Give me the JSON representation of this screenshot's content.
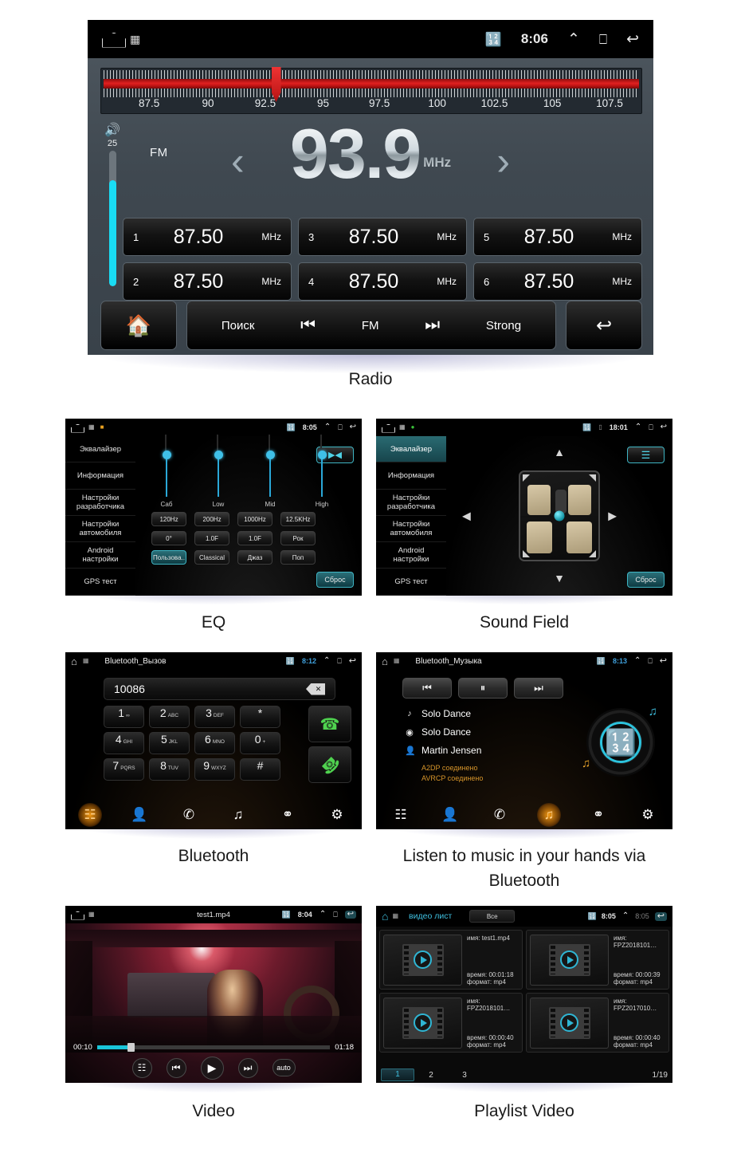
{
  "captions": {
    "radio": "Radio",
    "eq": "EQ",
    "sound_field": "Sound Field",
    "bluetooth": "Bluetooth",
    "bluetooth_music": "Listen to music in your hands via Bluetooth",
    "video": "Video",
    "playlist_video": "Playlist Video"
  },
  "radio": {
    "status": {
      "time": "8:06",
      "bluetooth_icon": "bluetooth-icon",
      "home_icon": "home-icon",
      "app_icon": "app-icon",
      "up_icon": "chevron-up-icon",
      "recents_icon": "recents-icon",
      "back_icon": "back-icon"
    },
    "tuner": {
      "labels": [
        "87.5",
        "90",
        "92.5",
        "95",
        "97.5",
        "100",
        "102.5",
        "105",
        "107.5"
      ],
      "needle_value": "93.9",
      "range_min": 87.0,
      "range_max": 108.5
    },
    "volume": {
      "level": "25",
      "percent": 78
    },
    "band": "FM",
    "frequency": "93.9",
    "unit": "MHz",
    "prev_arrow": "‹",
    "next_arrow": "›",
    "presets": [
      {
        "index": "1",
        "freq": "87.50",
        "unit": "MHz"
      },
      {
        "index": "3",
        "freq": "87.50",
        "unit": "MHz"
      },
      {
        "index": "5",
        "freq": "87.50",
        "unit": "MHz"
      },
      {
        "index": "2",
        "freq": "87.50",
        "unit": "MHz"
      },
      {
        "index": "4",
        "freq": "87.50",
        "unit": "MHz"
      },
      {
        "index": "6",
        "freq": "87.50",
        "unit": "MHz"
      }
    ],
    "toolbar": {
      "home": "⌂",
      "search": "Поиск",
      "prev": "⏮",
      "band": "FM",
      "next": "⏭",
      "strong": "Strong",
      "back": "↩"
    }
  },
  "eq": {
    "status": {
      "time": "8:05"
    },
    "menu": [
      {
        "label": "Эквалайзер",
        "active": false
      },
      {
        "label": "Информация",
        "active": false
      },
      {
        "label": "Настройки разработчика",
        "active": false
      },
      {
        "label": "Настройки автомобиля",
        "active": false
      },
      {
        "label": "Android настройки",
        "active": false
      },
      {
        "label": "GPS тест",
        "active": false
      }
    ],
    "sliders": [
      {
        "label": "Саб"
      },
      {
        "label": "Low"
      },
      {
        "label": "Mid"
      },
      {
        "label": "High"
      }
    ],
    "buttons_row1": [
      "120Hz",
      "200Hz",
      "1000Hz",
      "12.5KHz"
    ],
    "buttons_row2": [
      "0°",
      "1.0F",
      "1.0F",
      "Рок"
    ],
    "buttons_row3": [
      "Пользова..",
      "Classical",
      "Джаз",
      "Поп"
    ],
    "active_preset_index": 0,
    "top_button_icon": "balance-icon",
    "reset_label": "Сброс"
  },
  "sound_field": {
    "status": {
      "time": "18:01"
    },
    "menu": [
      {
        "label": "Эквалайзер",
        "active": true
      },
      {
        "label": "Информация",
        "active": false
      },
      {
        "label": "Настройки разработчика",
        "active": false
      },
      {
        "label": "Настройки автомобиля",
        "active": false
      },
      {
        "label": "Android настройки",
        "active": false
      },
      {
        "label": "GPS тест",
        "active": false
      }
    ],
    "top_button_icon": "equalizer-icon",
    "reset_label": "Сброс",
    "arrows": {
      "up": "▲",
      "down": "▼",
      "left": "◀",
      "right": "▶"
    }
  },
  "bluetooth": {
    "status": {
      "time": "8:12"
    },
    "title": "Bluetooth_Вызов",
    "dial_value": "10086",
    "backspace_icon": "backspace-icon",
    "keys": [
      {
        "big": "1",
        "sub": "∞"
      },
      {
        "big": "2",
        "sub": "ABC"
      },
      {
        "big": "3",
        "sub": "DEF"
      },
      {
        "big": "*",
        "sub": ""
      },
      {
        "big": "4",
        "sub": "GHI"
      },
      {
        "big": "5",
        "sub": "JKL"
      },
      {
        "big": "6",
        "sub": "MNO"
      },
      {
        "big": "0",
        "sub": "+"
      },
      {
        "big": "7",
        "sub": "PQRS"
      },
      {
        "big": "8",
        "sub": "TUV"
      },
      {
        "big": "9",
        "sub": "WXYZ"
      },
      {
        "big": "#",
        "sub": ""
      }
    ],
    "call_icon": "call-icon",
    "hangup_icon": "hangup-icon",
    "tabs": [
      {
        "icon": "keypad-icon",
        "glyph": "☷",
        "active": true
      },
      {
        "icon": "contacts-icon",
        "glyph": "὆4",
        "active": false
      },
      {
        "icon": "call-history-icon",
        "glyph": "✆",
        "active": false
      },
      {
        "icon": "music-icon",
        "glyph": "♫",
        "active": false
      },
      {
        "icon": "link-icon",
        "glyph": "⚭",
        "active": false
      },
      {
        "icon": "settings-icon",
        "glyph": "⚙",
        "active": false
      }
    ]
  },
  "bluetooth_music": {
    "status": {
      "time": "8:13"
    },
    "title": "Bluetooth_Музыка",
    "controls": [
      {
        "icon": "previous-icon",
        "glyph": "⏮"
      },
      {
        "icon": "pause-icon",
        "glyph": "⏸"
      },
      {
        "icon": "next-icon",
        "glyph": "⏭"
      }
    ],
    "track": "Solo Dance",
    "album": "Solo Dance",
    "artist": "Martin Jensen",
    "a2dp_status": "A2DP соединено",
    "avrcp_status": "AVRCP соединено",
    "tabs": [
      {
        "icon": "keypad-icon",
        "glyph": "☷",
        "active": false
      },
      {
        "icon": "contacts-icon",
        "glyph": "὆4",
        "active": false
      },
      {
        "icon": "call-history-icon",
        "glyph": "✆",
        "active": false
      },
      {
        "icon": "music-icon",
        "glyph": "♫",
        "active": true
      },
      {
        "icon": "link-icon",
        "glyph": "⚭",
        "active": false
      },
      {
        "icon": "settings-icon",
        "glyph": "⚙",
        "active": false
      }
    ]
  },
  "video": {
    "status": {
      "time": "8:04"
    },
    "title": "test1.mp4",
    "elapsed": "00:10",
    "duration": "01:18",
    "progress_percent": 13,
    "controls": [
      {
        "icon": "settings-sliders-icon",
        "glyph": "☷"
      },
      {
        "icon": "previous-icon",
        "glyph": "⏮"
      },
      {
        "icon": "play-icon",
        "glyph": "▶"
      },
      {
        "icon": "next-icon",
        "glyph": "⏭"
      },
      {
        "icon": "auto-button",
        "glyph": "auto"
      }
    ]
  },
  "playlist_video": {
    "status": {
      "time": "8:05",
      "secondary_time": "8:05"
    },
    "title": "видео лист",
    "filter_label": "Все",
    "field_labels": {
      "name": "имя:",
      "time": "время:",
      "format": "формат:"
    },
    "items": [
      {
        "name": "test1.mp4",
        "time": "00:01:18",
        "format": "mp4"
      },
      {
        "name": "FPZ2018101…",
        "time": "00:00:39",
        "format": "mp4"
      },
      {
        "name": "FPZ2018101…",
        "time": "00:00:40",
        "format": "mp4"
      },
      {
        "name": "FPZ2017010…",
        "time": "00:00:40",
        "format": "mp4"
      }
    ],
    "pages": [
      "1",
      "2",
      "3"
    ],
    "active_page": "1",
    "page_count": "1/19"
  }
}
